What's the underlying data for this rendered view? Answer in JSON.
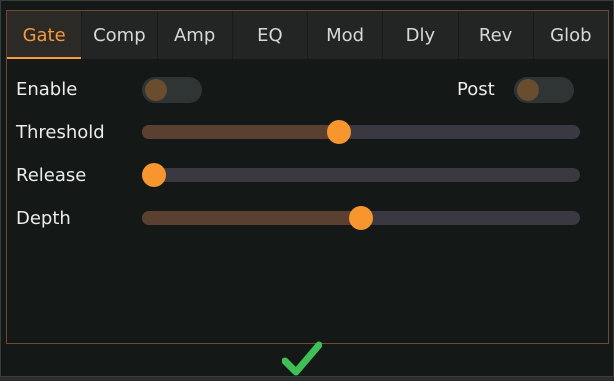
{
  "tabs": [
    {
      "label": "Gate",
      "active": true
    },
    {
      "label": "Comp",
      "active": false
    },
    {
      "label": "Amp",
      "active": false
    },
    {
      "label": "EQ",
      "active": false
    },
    {
      "label": "Mod",
      "active": false
    },
    {
      "label": "Dly",
      "active": false
    },
    {
      "label": "Rev",
      "active": false
    },
    {
      "label": "Glob",
      "active": false
    }
  ],
  "gate": {
    "enable": {
      "label": "Enable",
      "on": false
    },
    "post": {
      "label": "Post",
      "on": false
    },
    "sliders": [
      {
        "label": "Threshold",
        "value": 0.45
      },
      {
        "label": "Release",
        "value": 0.0
      },
      {
        "label": "Depth",
        "value": 0.5
      }
    ]
  },
  "confirm": {
    "icon": "checkmark-icon"
  },
  "colors": {
    "accent": "#f7952f",
    "confirm": "#3fbf55"
  }
}
